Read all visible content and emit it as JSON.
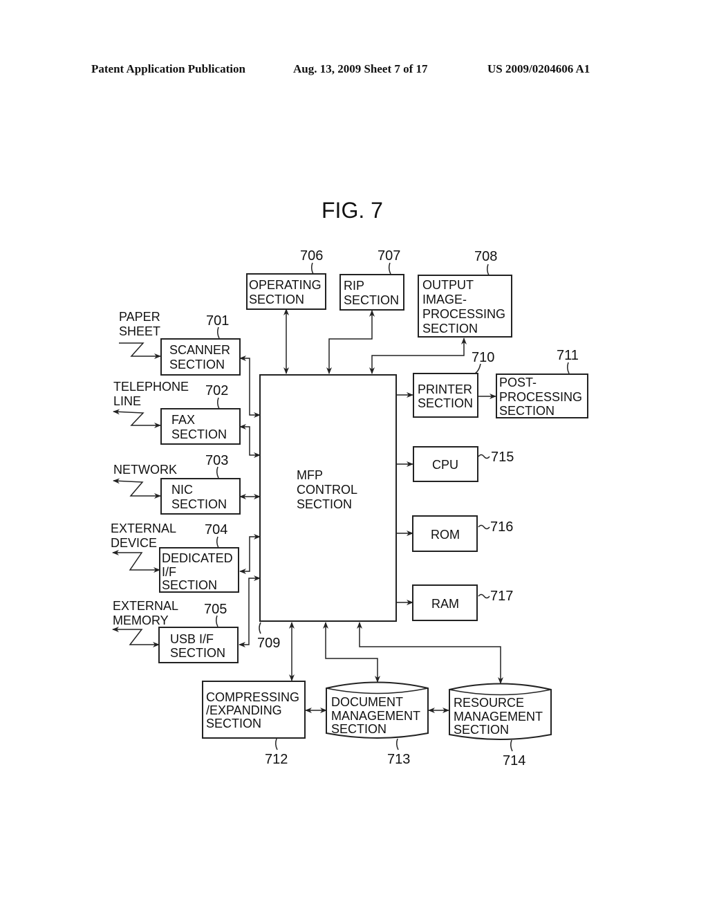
{
  "header": {
    "left": "Patent Application Publication",
    "middle": "Aug. 13, 2009  Sheet 7 of 17",
    "right": "US 2009/0204606 A1"
  },
  "figure": {
    "title": "FIG. 7",
    "control": {
      "ref": "709",
      "lines": [
        "MFP",
        "CONTROL",
        "SECTION"
      ]
    },
    "left_blocks": [
      {
        "ref": "701",
        "lines": [
          "SCANNER",
          "SECTION"
        ],
        "external": [
          "PAPER",
          "SHEET"
        ]
      },
      {
        "ref": "702",
        "lines": [
          "FAX",
          "SECTION"
        ],
        "external": [
          "TELEPHONE",
          "LINE"
        ]
      },
      {
        "ref": "703",
        "lines": [
          "NIC",
          "SECTION"
        ],
        "external": [
          "NETWORK"
        ]
      },
      {
        "ref": "704",
        "lines": [
          "DEDICATED",
          "I/F",
          "SECTION"
        ],
        "external": [
          "EXTERNAL",
          "DEVICE"
        ]
      },
      {
        "ref": "705",
        "lines": [
          "USB I/F",
          "SECTION"
        ],
        "external": [
          "EXTERNAL",
          "MEMORY"
        ]
      }
    ],
    "top_blocks": [
      {
        "ref": "706",
        "lines": [
          "OPERATING",
          "SECTION"
        ]
      },
      {
        "ref": "707",
        "lines": [
          "RIP",
          "SECTION"
        ]
      },
      {
        "ref": "708",
        "lines": [
          "OUTPUT",
          "IMAGE-",
          "PROCESSING",
          "SECTION"
        ]
      }
    ],
    "right_blocks": [
      {
        "ref": "710",
        "lines": [
          "PRINTER",
          "SECTION"
        ]
      },
      {
        "ref": "711",
        "lines": [
          "POST-",
          "PROCESSING",
          "SECTION"
        ]
      },
      {
        "ref": "715",
        "lines": [
          "CPU"
        ]
      },
      {
        "ref": "716",
        "lines": [
          "ROM"
        ]
      },
      {
        "ref": "717",
        "lines": [
          "RAM"
        ]
      }
    ],
    "bottom_blocks": [
      {
        "ref": "712",
        "lines": [
          "COMPRESSING",
          "/EXPANDING",
          "SECTION"
        ]
      },
      {
        "ref": "713",
        "lines": [
          "DOCUMENT",
          "MANAGEMENT",
          "SECTION"
        ]
      },
      {
        "ref": "714",
        "lines": [
          "RESOURCE",
          "MANAGEMENT",
          "SECTION"
        ]
      }
    ]
  }
}
